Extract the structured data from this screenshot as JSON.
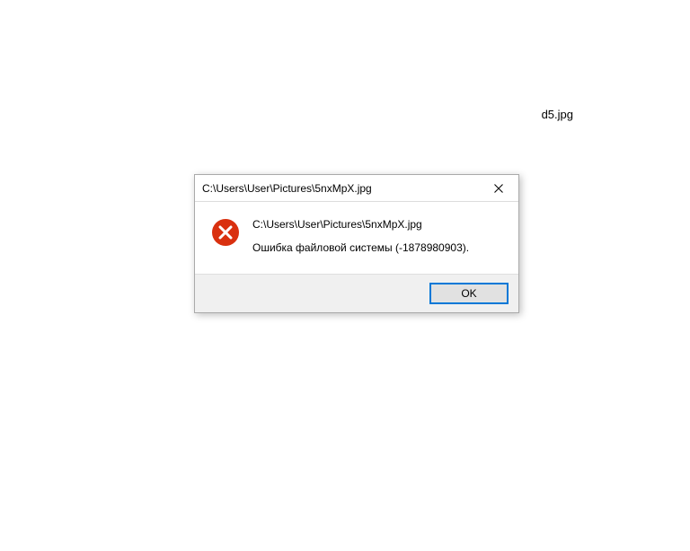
{
  "background": {
    "label": "d5.jpg"
  },
  "dialog": {
    "title": "C:\\Users\\User\\Pictures\\5nxMpX.jpg",
    "message_heading": "C:\\Users\\User\\Pictures\\5nxMpX.jpg",
    "message_body": "Ошибка файловой системы (-1878980903).",
    "ok_label": "OK"
  }
}
